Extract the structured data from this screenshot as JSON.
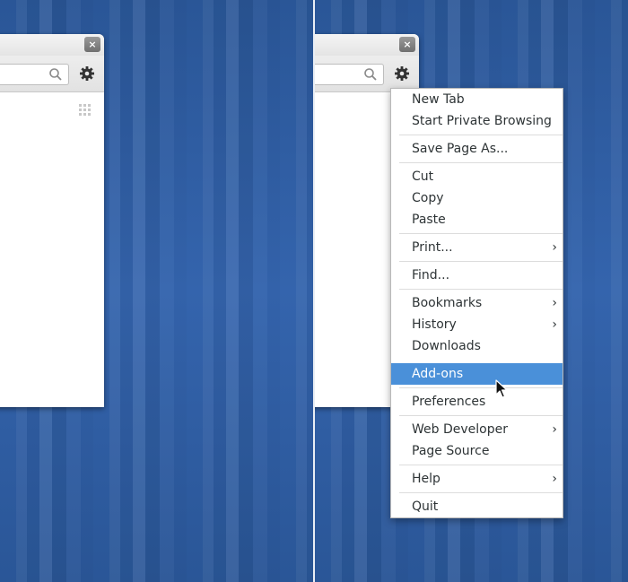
{
  "left_window": {
    "close_glyph": "×",
    "icons": [
      "close-icon",
      "search-icon",
      "gear-icon",
      "apps-grid-icon"
    ]
  },
  "right_window": {
    "close_glyph": "×"
  },
  "menu": {
    "items": [
      {
        "label": "New Tab",
        "submenu": false
      },
      {
        "label": "Start Private Browsing",
        "submenu": false
      },
      {
        "label": "Save Page As...",
        "submenu": false
      },
      {
        "label": "Cut",
        "submenu": false
      },
      {
        "label": "Copy",
        "submenu": false
      },
      {
        "label": "Paste",
        "submenu": false
      },
      {
        "label": "Print...",
        "submenu": true
      },
      {
        "label": "Find...",
        "submenu": false
      },
      {
        "label": "Bookmarks",
        "submenu": true
      },
      {
        "label": "History",
        "submenu": true
      },
      {
        "label": "Downloads",
        "submenu": false
      },
      {
        "label": "Add-ons",
        "submenu": false,
        "highlighted": true
      },
      {
        "label": "Preferences",
        "submenu": false
      },
      {
        "label": "Web Developer",
        "submenu": true
      },
      {
        "label": "Page Source",
        "submenu": false
      },
      {
        "label": "Help",
        "submenu": true
      },
      {
        "label": "Quit",
        "submenu": false
      }
    ],
    "chevron_glyph": "›"
  },
  "colors": {
    "highlight": "#4a90d9",
    "desktop": "#2f5a9e"
  }
}
